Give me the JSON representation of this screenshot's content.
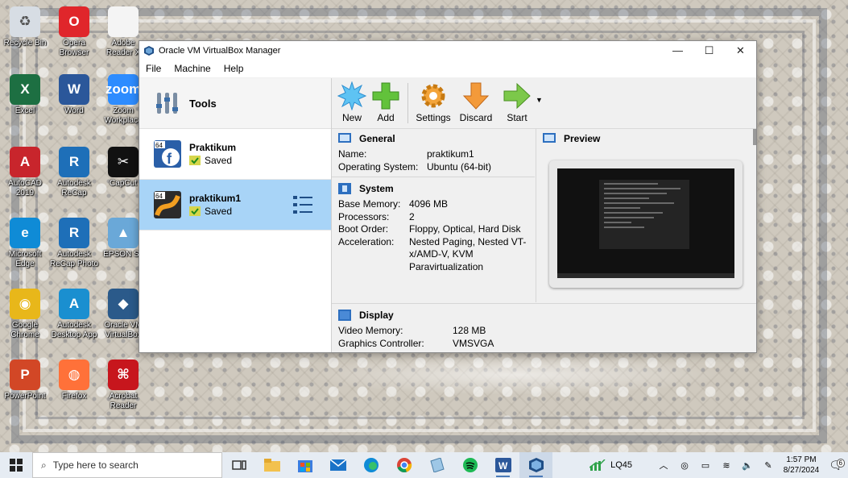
{
  "desktop": {
    "icons": [
      {
        "label": "Recycle Bin",
        "glyph": "♻",
        "color": "#d7dde4"
      },
      {
        "label": "Opera\nBrowser",
        "glyph": "O",
        "color": "#e0262b"
      },
      {
        "label": "Adobe\nReader X",
        "glyph": "",
        "color": "#f4f4f4"
      },
      {
        "label": "Excel",
        "glyph": "X",
        "color": "#1d6f42"
      },
      {
        "label": "Word",
        "glyph": "W",
        "color": "#2b579a"
      },
      {
        "label": "Zoom\nWorkplace",
        "glyph": "zoom",
        "color": "#2d8cff"
      },
      {
        "label": "AutoCAD\n2019",
        "glyph": "A",
        "color": "#c8252c"
      },
      {
        "label": "Autodesk\nReCap",
        "glyph": "R",
        "color": "#1e6fb8"
      },
      {
        "label": "CapCut",
        "glyph": "✂",
        "color": "#111111"
      },
      {
        "label": "Microsoft\nEdge",
        "glyph": "e",
        "color": "#0f8bd6"
      },
      {
        "label": "Autodesk\nReCap Photo",
        "glyph": "R",
        "color": "#1e6fb8"
      },
      {
        "label": "EPSON Sc",
        "glyph": "▲",
        "color": "#6aa8d8"
      },
      {
        "label": "Google\nChrome",
        "glyph": "◉",
        "color": "#e8b71a"
      },
      {
        "label": "Autodesk\nDesktop App",
        "glyph": "A",
        "color": "#1a8fd0"
      },
      {
        "label": "Oracle VM\nVirtualBox",
        "glyph": "◆",
        "color": "#2b5a8a"
      },
      {
        "label": "PowerPoint",
        "glyph": "P",
        "color": "#d24726"
      },
      {
        "label": "Firefox",
        "glyph": "◍",
        "color": "#ff7139"
      },
      {
        "label": "Acrobat\nReader",
        "glyph": "⌘",
        "color": "#c7161d"
      }
    ]
  },
  "window": {
    "title": "Oracle VM VirtualBox Manager",
    "controls": {
      "minimize": "—",
      "maximize": "☐",
      "close": "✕"
    },
    "menu": [
      "File",
      "Machine",
      "Help"
    ]
  },
  "left": {
    "tools_label": "Tools",
    "vms": [
      {
        "name": "Praktikum",
        "state": "Saved",
        "os_badge": "64"
      },
      {
        "name": "praktikum1",
        "state": "Saved",
        "os_badge": "64"
      }
    ]
  },
  "toolbar": {
    "buttons": [
      "New",
      "Add",
      "Settings",
      "Discard",
      "Start"
    ]
  },
  "details": {
    "general": {
      "title": "General",
      "rows": [
        {
          "k": "Name:",
          "v": "praktikum1"
        },
        {
          "k": "Operating System:",
          "v": "Ubuntu (64-bit)"
        }
      ]
    },
    "system": {
      "title": "System",
      "rows": [
        {
          "k": "Base Memory:",
          "v": "4096 MB"
        },
        {
          "k": "Processors:",
          "v": "2"
        },
        {
          "k": "Boot Order:",
          "v": "Floppy, Optical, Hard Disk"
        },
        {
          "k": "Acceleration:",
          "v": "Nested Paging, Nested VT-x/AMD-V, KVM Paravirtualization"
        }
      ]
    },
    "display": {
      "title": "Display",
      "rows": [
        {
          "k": "Video Memory:",
          "v": "128 MB"
        },
        {
          "k": "Graphics Controller:",
          "v": "VMSVGA"
        }
      ]
    }
  },
  "preview": {
    "title": "Preview"
  },
  "taskbar": {
    "search_placeholder": "Type here to search",
    "apps": [
      "task-view",
      "file-explorer",
      "microsoft-store",
      "mail",
      "edge",
      "chrome",
      "notepad",
      "spotify",
      "word",
      "virtualbox"
    ],
    "stock": "LQ45",
    "time": "1:57 PM",
    "date": "8/27/2024",
    "notifications": "6"
  }
}
